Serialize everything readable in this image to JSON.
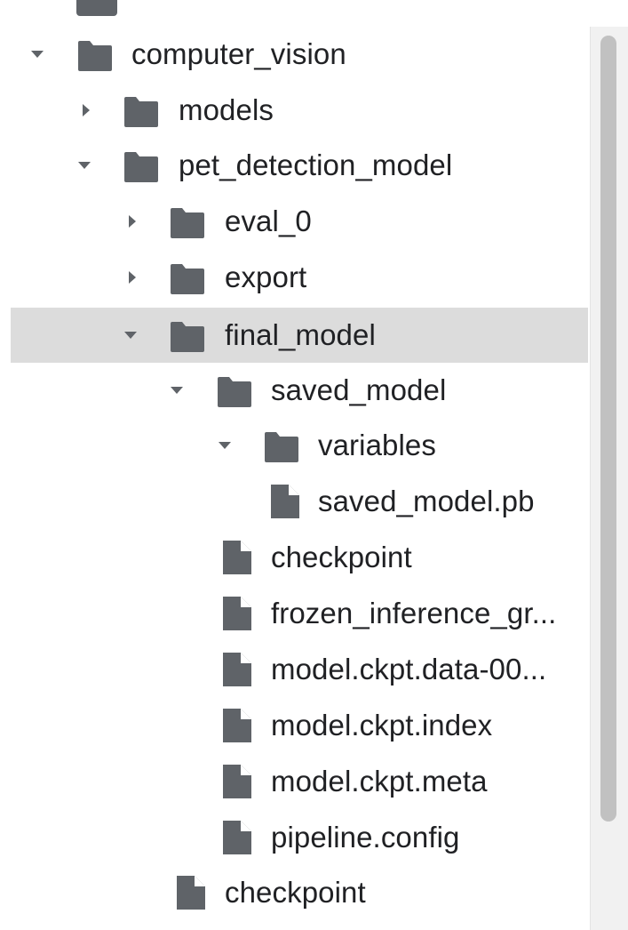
{
  "file_tree": {
    "items": [
      {
        "label": "computer_vision",
        "type": "folder",
        "expanded": true,
        "level": 0
      },
      {
        "label": "models",
        "type": "folder",
        "expanded": false,
        "level": 1
      },
      {
        "label": "pet_detection_model",
        "type": "folder",
        "expanded": true,
        "level": 1
      },
      {
        "label": "eval_0",
        "type": "folder",
        "expanded": false,
        "level": 2
      },
      {
        "label": "export",
        "type": "folder",
        "expanded": false,
        "level": 2
      },
      {
        "label": "final_model",
        "type": "folder",
        "expanded": true,
        "level": 2,
        "selected": true
      },
      {
        "label": "saved_model",
        "type": "folder",
        "expanded": true,
        "level": 3
      },
      {
        "label": "variables",
        "type": "folder",
        "expanded": true,
        "level": 4
      },
      {
        "label": "saved_model.pb",
        "type": "file",
        "level": 4
      },
      {
        "label": "checkpoint",
        "type": "file",
        "level": 3
      },
      {
        "label": "frozen_inference_gr...",
        "type": "file",
        "level": 3
      },
      {
        "label": "model.ckpt.data-00...",
        "type": "file",
        "level": 3
      },
      {
        "label": "model.ckpt.index",
        "type": "file",
        "level": 3
      },
      {
        "label": "model.ckpt.meta",
        "type": "file",
        "level": 3
      },
      {
        "label": "pipeline.config",
        "type": "file",
        "level": 3
      },
      {
        "label": "checkpoint",
        "type": "file",
        "level": 2
      }
    ]
  },
  "icons": {
    "folder": "folder-icon",
    "file": "file-icon",
    "expanded": "chevron-down-icon",
    "collapsed": "chevron-right-icon"
  },
  "colors": {
    "icon": "#5f6368",
    "text": "#202124",
    "selected_row": "#dcdcdc",
    "scrollbar_thumb": "#c1c1c1"
  }
}
